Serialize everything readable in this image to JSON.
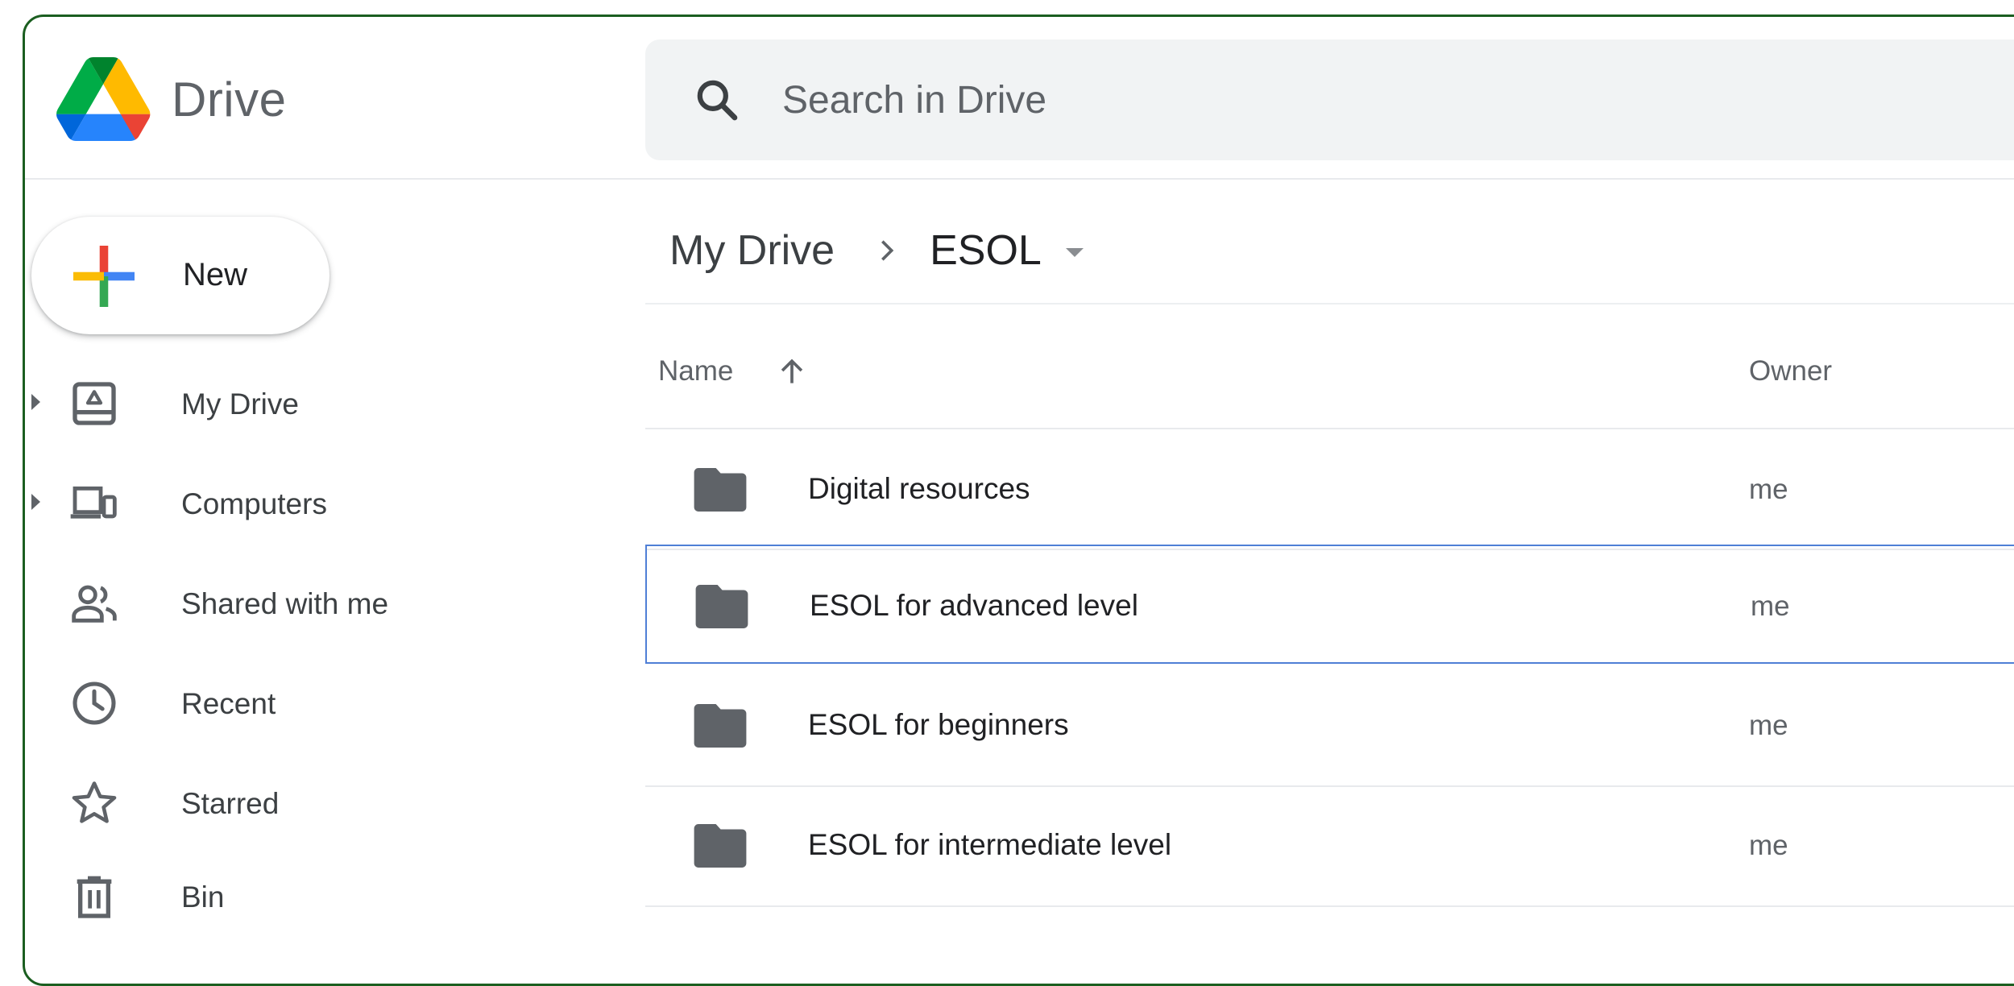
{
  "app": {
    "name": "Drive",
    "colors": {
      "frame_border": "#1b5e20",
      "logo_green": "#0f9d58",
      "logo_yellow": "#f4b400",
      "logo_blue": "#4285f4",
      "logo_red": "#db4437",
      "selection_border": "#4f7fd6",
      "icon_grey": "#5f6368"
    }
  },
  "search": {
    "placeholder": "Search in Drive",
    "icon": "search-icon"
  },
  "sidebar": {
    "new_button": {
      "label": "New",
      "icon": "plus-icon"
    },
    "items": [
      {
        "label": "My Drive",
        "icon": "my-drive-icon",
        "expandable": true
      },
      {
        "label": "Computers",
        "icon": "computers-icon",
        "expandable": true
      },
      {
        "label": "Shared with me",
        "icon": "shared-icon",
        "expandable": false
      },
      {
        "label": "Recent",
        "icon": "clock-icon",
        "expandable": false
      },
      {
        "label": "Starred",
        "icon": "star-icon",
        "expandable": false
      },
      {
        "label": "Bin",
        "icon": "trash-icon",
        "expandable": false
      }
    ]
  },
  "breadcrumb": {
    "root": "My Drive",
    "current": "ESOL"
  },
  "table": {
    "columns": {
      "name": "Name",
      "owner": "Owner"
    },
    "sort": {
      "column": "Name",
      "direction": "ascending"
    },
    "rows": [
      {
        "name": "Digital resources",
        "owner": "me",
        "type": "folder",
        "selected": false
      },
      {
        "name": "ESOL for advanced level",
        "owner": "me",
        "type": "folder",
        "selected": true
      },
      {
        "name": "ESOL for beginners",
        "owner": "me",
        "type": "folder",
        "selected": false
      },
      {
        "name": "ESOL for intermediate level",
        "owner": "me",
        "type": "folder",
        "selected": false
      }
    ]
  }
}
